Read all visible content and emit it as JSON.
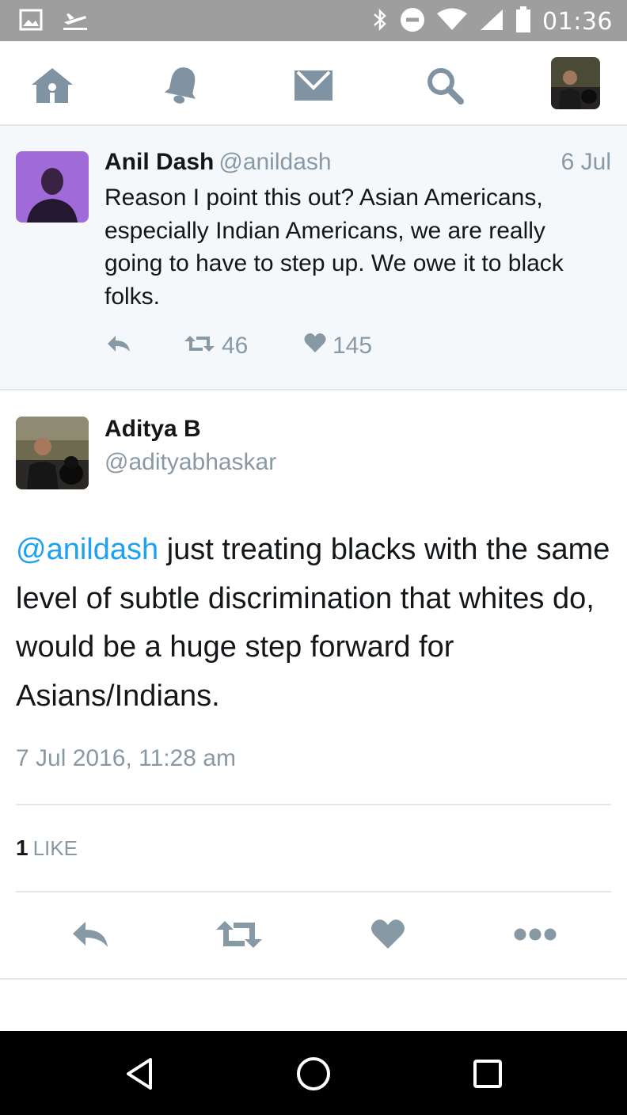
{
  "status_bar": {
    "time": "01:36",
    "icons": [
      "image-icon",
      "airplane-mode-icon",
      "bluetooth-icon",
      "do-not-disturb-icon",
      "wifi-icon",
      "signal-icon",
      "battery-icon"
    ]
  },
  "nav": {
    "items": [
      "home-icon",
      "notifications-icon",
      "messages-icon",
      "search-icon",
      "profile-avatar"
    ]
  },
  "parent_tweet": {
    "name": "Anil Dash",
    "handle": "@anildash",
    "date": "6 Jul",
    "text_lines": [
      "Reason I point this out? Asian Americans,",
      "especially Indian Americans, we are really",
      "going to have to step up. We owe it to black",
      "folks."
    ],
    "retweets": "46",
    "likes": "145",
    "avatar_color": "#a06ad8"
  },
  "tweet": {
    "name": "Aditya B",
    "handle": "@adityabhaskar",
    "mention": "@anildash",
    "text": " just treating blacks with the same level of subtle discrimination that whites do, would be a huge step forward for Asians/Indians.",
    "timestamp": "7 Jul 2016, 11:28 am",
    "like_count": "1",
    "like_label": "LIKE"
  },
  "colors": {
    "accent": "#1da1f2",
    "icon_gray": "#8899a6",
    "nav_icon": "#7f93a3",
    "status_bar": "#9e9e9e"
  }
}
